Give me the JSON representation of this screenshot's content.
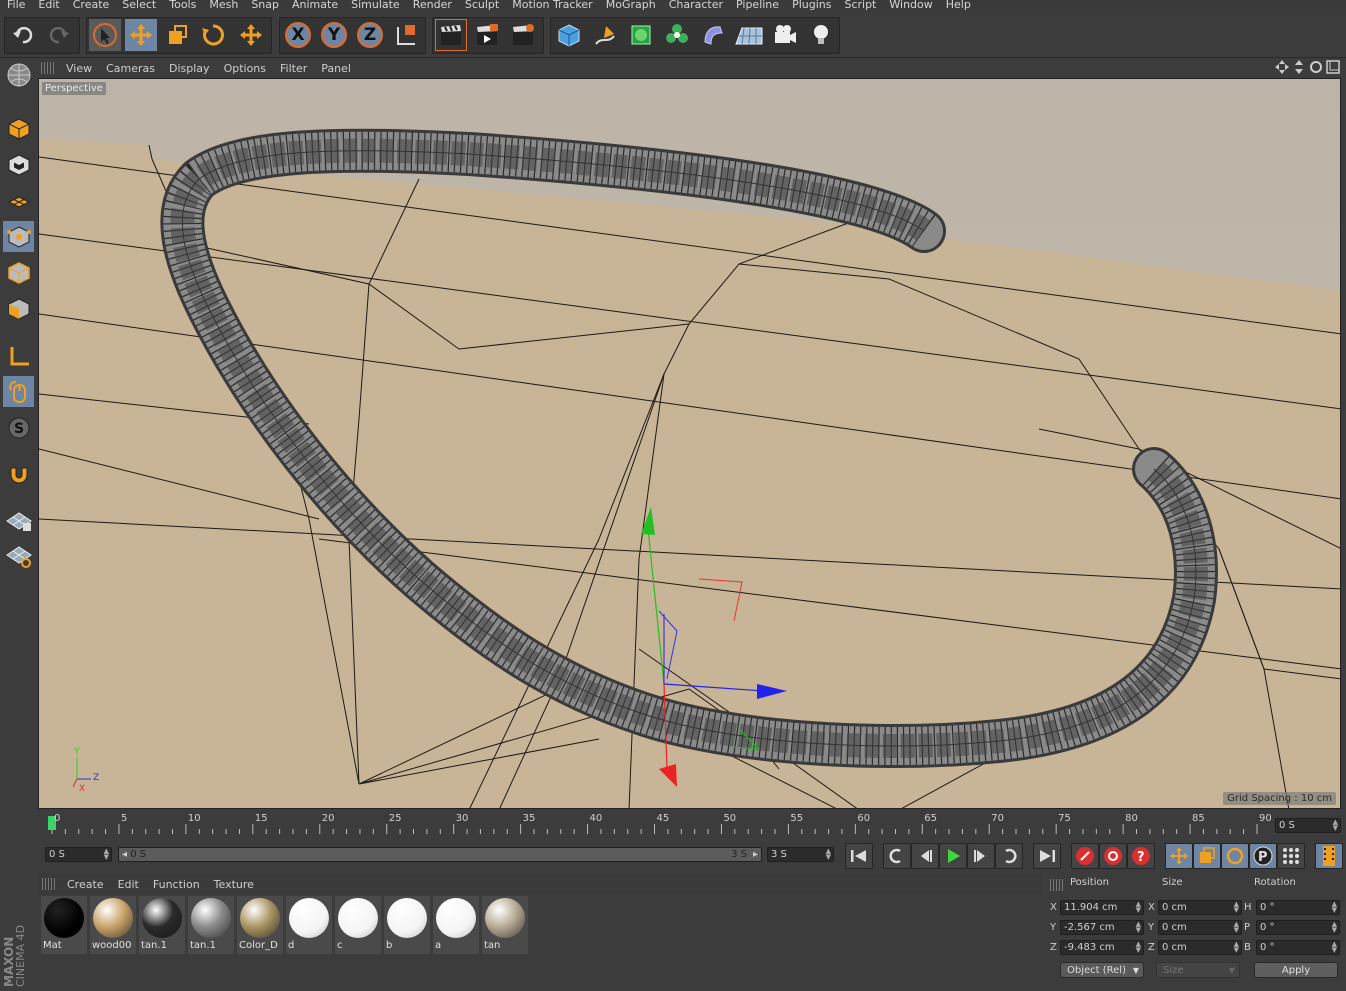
{
  "menubar": [
    "File",
    "Edit",
    "Create",
    "Select",
    "Tools",
    "Mesh",
    "Snap",
    "Animate",
    "Simulate",
    "Render",
    "Sculpt",
    "Motion Tracker",
    "MoGraph",
    "Character",
    "Pipeline",
    "Plugins",
    "Script",
    "Window",
    "Help"
  ],
  "toolbar": {
    "axis_x": "X",
    "axis_y": "Y",
    "axis_z": "Z"
  },
  "viewport": {
    "menu": [
      "View",
      "Cameras",
      "Display",
      "Options",
      "Filter",
      "Panel"
    ],
    "label": "Perspective",
    "grid_spacing": "Grid Spacing : 10 cm",
    "axis_y": "Y",
    "axis_z": "Z",
    "axis_x": "X"
  },
  "timeline": {
    "ticks": [
      "0",
      "5",
      "10",
      "15",
      "20",
      "25",
      "30",
      "35",
      "40",
      "45",
      "50",
      "55",
      "60",
      "65",
      "70",
      "75",
      "80",
      "85",
      "90"
    ],
    "current_frame": "0 S",
    "start_field": "0 S",
    "range_start": "0 S",
    "range_end": "3 S",
    "end_field": "3 S"
  },
  "materials": {
    "menu": [
      "Create",
      "Edit",
      "Function",
      "Texture"
    ],
    "items": [
      {
        "name": "Mat",
        "color": "#050505"
      },
      {
        "name": "wood00",
        "color": "#c9a46a"
      },
      {
        "name": "tan.1",
        "color": "#2a2a2a"
      },
      {
        "name": "tan.1",
        "color": "#8a8a8a"
      },
      {
        "name": "Color_D",
        "color": "#a99462"
      },
      {
        "name": "d",
        "color": "#f2f2f2"
      },
      {
        "name": "c",
        "color": "#f2f2f2"
      },
      {
        "name": "b",
        "color": "#f2f2f2"
      },
      {
        "name": "a",
        "color": "#f2f2f2"
      },
      {
        "name": "tan",
        "color": "#b8ab95"
      }
    ]
  },
  "coords": {
    "position_label": "Position",
    "size_label": "Size",
    "rotation_label": "Rotation",
    "x_label": "X",
    "y_label": "Y",
    "z_label": "Z",
    "h_label": "H",
    "p_label": "P",
    "b_label": "B",
    "pos_x": "11.904 cm",
    "pos_y": "-2.567 cm",
    "pos_z": "-9.483 cm",
    "size_x": "0 cm",
    "size_y": "0 cm",
    "size_z": "0 cm",
    "rot_h": "0 °",
    "rot_p": "0 °",
    "rot_b": "0 °",
    "mode": "Object (Rel)",
    "size_mode": "Size",
    "apply": "Apply"
  },
  "branding": {
    "line1": "MAXON",
    "line2": "CINEMA 4D"
  }
}
